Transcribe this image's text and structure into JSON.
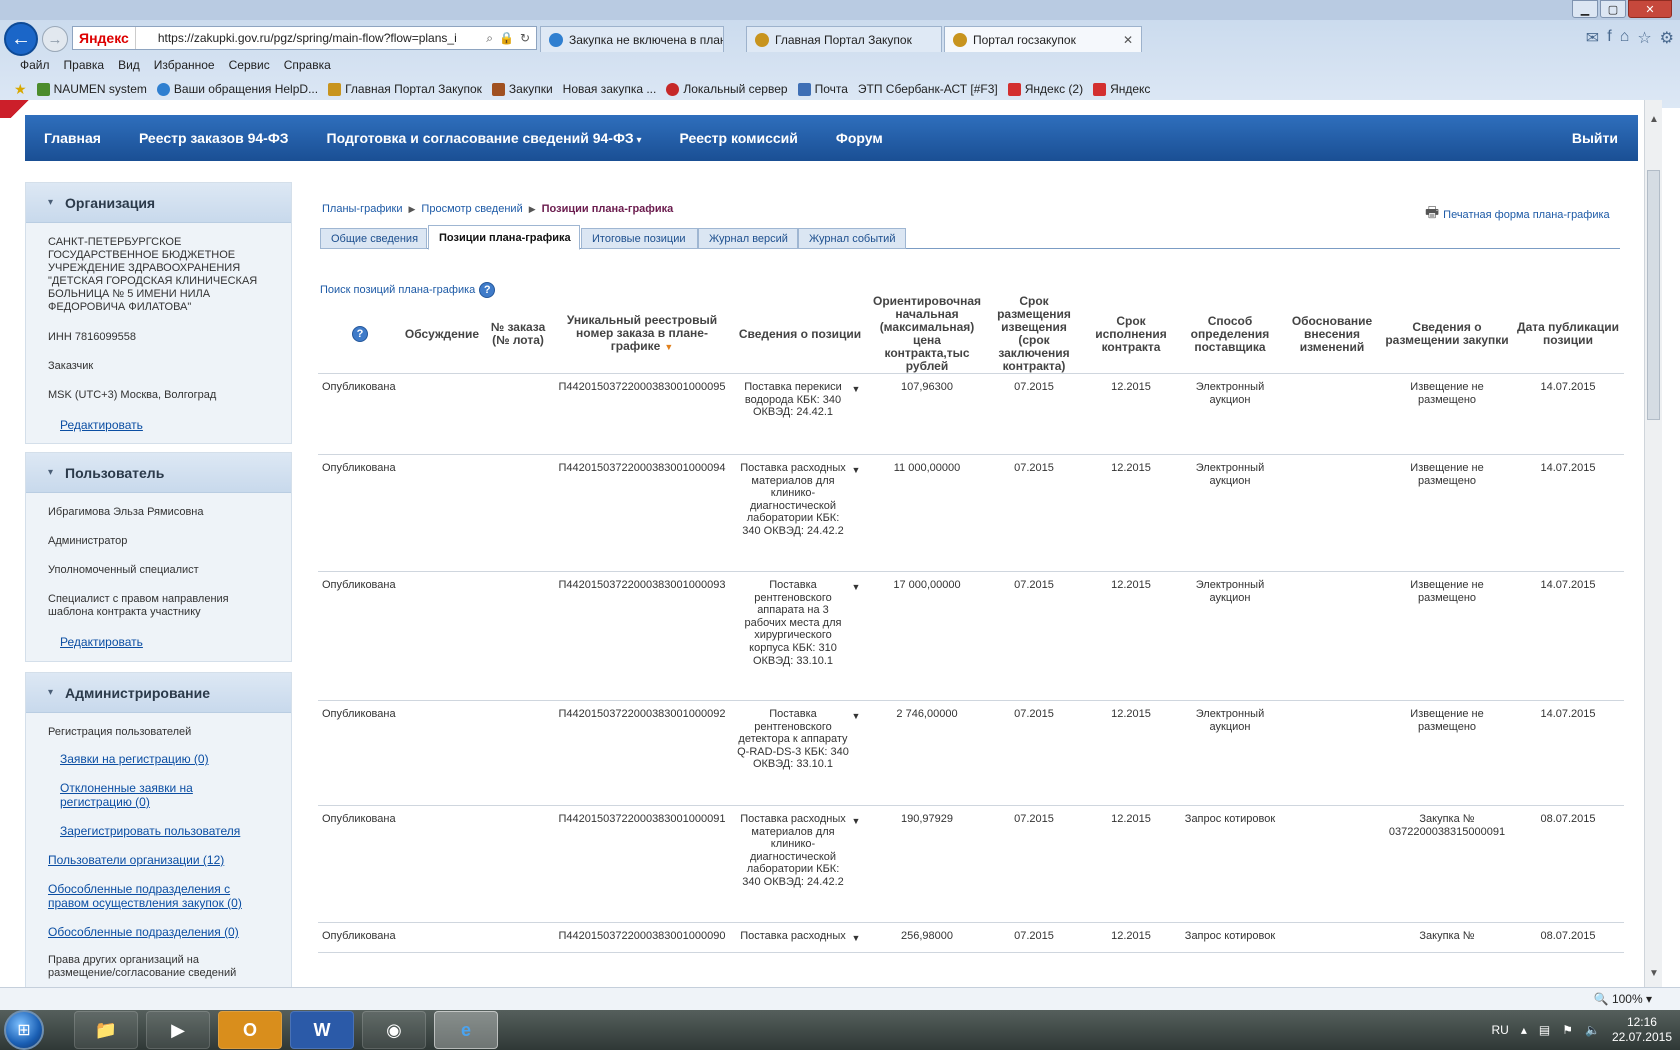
{
  "browser": {
    "window_buttons": {
      "minimize": "▁",
      "maximize": "▢",
      "close": "✕"
    },
    "back": "←",
    "forward": "→",
    "address": {
      "brand": "Яндекс",
      "url": "https://zakupki.gov.ru/pgz/spring/main-flow?flow=plans_i"
    },
    "tabs": [
      {
        "label": "Закупка не включена в план-...",
        "icon_color": "#2f7fd0"
      },
      {
        "label": "Главная Портал Закупок",
        "icon_color": "#c8941e"
      },
      {
        "label": "Портал госзакупок",
        "icon_color": "#c8941e",
        "close": "✕"
      }
    ],
    "menu": [
      "Файл",
      "Правка",
      "Вид",
      "Избранное",
      "Сервис",
      "Справка"
    ],
    "favorites": [
      {
        "label": "NAUMEN system",
        "icon_color": "#4c8c2c"
      },
      {
        "label": "Ваши обращения HelpD...",
        "icon_color": "#2f7fd0"
      },
      {
        "label": "Главная Портал Закупок",
        "icon_color": "#c8941e"
      },
      {
        "label": "Закупки",
        "icon_color": "#a05020"
      },
      {
        "label": "Новая закупка ...",
        "icon_color": "#ffffff"
      },
      {
        "label": "Локальный сервер",
        "icon_color": "#c62828"
      },
      {
        "label": "Почта",
        "icon_color": "#3f6fb5"
      },
      {
        "label": "ЭТП Сбербанк-АСТ [#F3]",
        "icon_color": "#ffffff"
      },
      {
        "label": "Яндекс (2)",
        "icon_color": "#d32f2f"
      },
      {
        "label": "Яндекс",
        "icon_color": "#d32f2f"
      }
    ],
    "zoom": "100%"
  },
  "nav": {
    "items": [
      "Главная",
      "Реестр заказов 94-ФЗ",
      "Подготовка и согласование сведений 94-ФЗ",
      "Реестр комиссий",
      "Форум"
    ],
    "logout": "Выйти"
  },
  "sidebar": {
    "org": {
      "title": "Организация",
      "name": "САНКТ-ПЕТЕРБУРГСКОЕ ГОСУДАРСТВЕННОЕ БЮДЖЕТНОЕ УЧРЕЖДЕНИЕ ЗДРАВООХРАНЕНИЯ \"ДЕТСКАЯ ГОРОДСКАЯ КЛИНИЧЕСКАЯ БОЛЬНИЦА № 5 ИМЕНИ НИЛА ФЕДОРОВИЧА ФИЛАТОВА\"",
      "inn": "ИНН 7816099558",
      "role": "Заказчик",
      "tz": "MSK (UTC+3) Москва, Волгоград",
      "edit": "Редактировать"
    },
    "user": {
      "title": "Пользователь",
      "name": "Ибрагимова Эльза Рямисовна",
      "roles": [
        "Администратор",
        "Уполномоченный специалист",
        "Специалист с правом направления шаблона контракта участнику"
      ],
      "edit": "Редактировать"
    },
    "admin": {
      "title": "Администрирование",
      "reg_label": "Регистрация пользователей",
      "reg_links": [
        "Заявки на регистрацию (0)",
        "Отклоненные заявки на регистрацию (0)",
        "Зарегистрировать пользователя"
      ],
      "links": [
        "Пользователи организации (12)",
        "Обособленные подразделения с правом осуществления закупок (0)",
        "Обособленные подразделения (0)"
      ],
      "rights_label": "Права других организаций на размещение/согласование сведений"
    }
  },
  "breadcrumb": {
    "items": [
      "Планы-графики",
      "Просмотр сведений"
    ],
    "current": "Позиции плана-графика"
  },
  "print_link": "Печатная форма плана-графика",
  "page_tabs": [
    "Общие сведения",
    "Позиции плана-графика",
    "Итоговые позиции",
    "Журнал версий",
    "Журнал событий"
  ],
  "search_link": "Поиск позиций плана-графика",
  "table": {
    "headers": {
      "help": "?",
      "discussion": "Обсуждение",
      "lot": "№ заказа (№ лота)",
      "unique_no": "Уникальный реестровый номер заказа в плане-графике",
      "info": "Сведения о позиции",
      "price": "Ориентировочная начальная (максимальная) цена контракта,тыс рублей",
      "notice_term": "Срок размещения извещения (срок заключения контракта)",
      "exec_term": "Срок исполнения контракта",
      "method": "Способ определения поставщика",
      "reason": "Обоснование внесения изменений",
      "purchase_info": "Сведения о размещении закупки",
      "pub_date": "Дата публикации позиции"
    },
    "rows": [
      {
        "status": "Опубликована",
        "number": "П44201503722000383001000095",
        "info": "Поставка перекиси водорода КБК: 340 ОКВЭД: 24.42.1",
        "price": "107,96300",
        "notice": "07.2015",
        "exec": "12.2015",
        "method": "Электронный аукцион",
        "placement": "Извещение не размещено",
        "placement_is_link": false,
        "date": "14.07.2015"
      },
      {
        "status": "Опубликована",
        "number": "П44201503722000383001000094",
        "info": "Поставка расходных материалов для клинико-диагностической лаборатории КБК: 340 ОКВЭД: 24.42.2",
        "price": "11 000,00000",
        "notice": "07.2015",
        "exec": "12.2015",
        "method": "Электронный аукцион",
        "placement": "Извещение не размещено",
        "placement_is_link": false,
        "date": "14.07.2015"
      },
      {
        "status": "Опубликована",
        "number": "П44201503722000383001000093",
        "info": "Поставка рентгеновского аппарата на 3 рабочих места для хирургического корпуса КБК: 310 ОКВЭД: 33.10.1",
        "price": "17 000,00000",
        "notice": "07.2015",
        "exec": "12.2015",
        "method": "Электронный аукцион",
        "placement": "Извещение не размещено",
        "placement_is_link": false,
        "date": "14.07.2015"
      },
      {
        "status": "Опубликована",
        "number": "П44201503722000383001000092",
        "info": "Поставка рентгеновского детектора к аппарату Q-RAD-DS-3 КБК: 340 ОКВЭД: 33.10.1",
        "price": "2 746,00000",
        "notice": "07.2015",
        "exec": "12.2015",
        "method": "Электронный аукцион",
        "placement": "Извещение не размещено",
        "placement_is_link": false,
        "date": "14.07.2015"
      },
      {
        "status": "Опубликована",
        "number": "П44201503722000383001000091",
        "info": "Поставка расходных материалов для клинико-диагностической лаборатории КБК: 340 ОКВЭД: 24.42.2",
        "price": "190,97929",
        "notice": "07.2015",
        "exec": "12.2015",
        "method": "Запрос котировок",
        "placement": "Закупка № 0372200038315000091",
        "placement_is_link": true,
        "date": "08.07.2015"
      },
      {
        "status": "Опубликована",
        "number": "П44201503722000383001000090",
        "info": "Поставка расходных",
        "price": "256,98000",
        "notice": "07.2015",
        "exec": "12.2015",
        "method": "Запрос котировок",
        "placement": "Закупка №",
        "placement_is_link": true,
        "date": "08.07.2015"
      }
    ]
  },
  "taskbar": {
    "lang": "RU",
    "time": "12:16",
    "date": "22.07.2015"
  }
}
